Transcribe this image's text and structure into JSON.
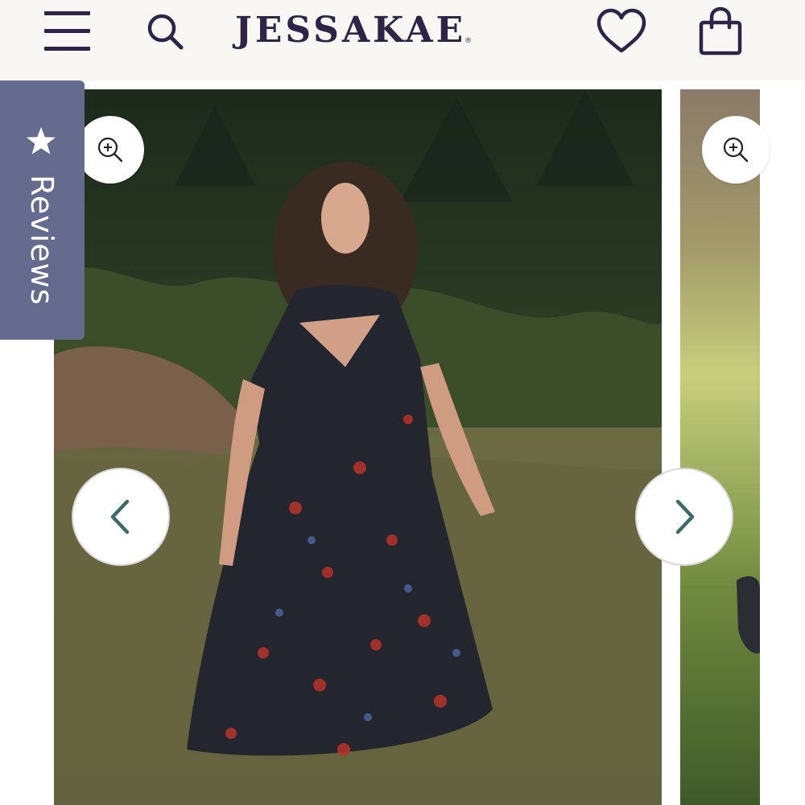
{
  "header": {
    "brand": "JESSAKAE",
    "brand_mark": "®",
    "icons": [
      "menu-icon",
      "search-icon",
      "heart-icon",
      "shopping-bag-icon"
    ]
  },
  "reviews_tab": {
    "label": "Reviews",
    "icon": "star-icon"
  },
  "gallery": {
    "slides": [
      {
        "subject": "woman-in-floral-dress-photo"
      },
      {
        "subject": "grass-field-photo"
      }
    ],
    "controls": [
      "zoom-in-icon",
      "chevron-left-icon",
      "chevron-right-icon"
    ]
  },
  "colors": {
    "brand": "#2f2447",
    "header_bg": "#f8f7f3",
    "reviews_tab": "#656a8f",
    "arrow": "#3d6b66"
  }
}
